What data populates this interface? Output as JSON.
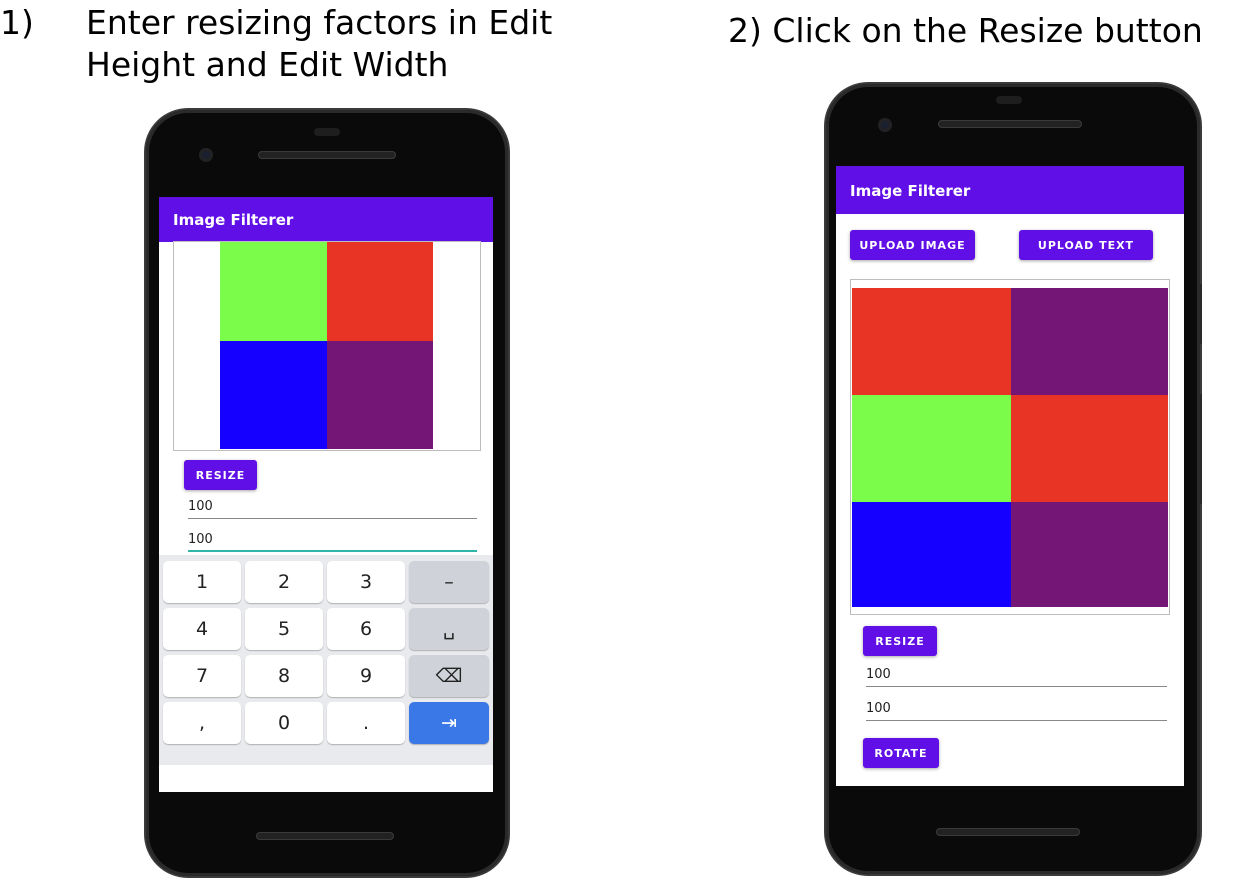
{
  "captions": {
    "step1_number": "1)",
    "step1_text": "Enter resizing factors in Edit Height and Edit Width",
    "step2_text": "2) Click on the Resize button"
  },
  "left_phone": {
    "app_title": "Image Filterer",
    "image_colors": [
      "#7cfc4a",
      "#e83424",
      "#1500ff",
      "#731675"
    ],
    "resize_label": "RESIZE",
    "height_value": "100",
    "width_value": "100",
    "keyboard": {
      "rows": [
        [
          "1",
          "2",
          "3",
          "–"
        ],
        [
          "4",
          "5",
          "6",
          "␣"
        ],
        [
          "7",
          "8",
          "9",
          "⌫"
        ],
        [
          ",",
          "0",
          ".",
          "⇥"
        ]
      ]
    }
  },
  "right_phone": {
    "app_title": "Image Filterer",
    "upload_image_label": "UPLOAD IMAGE",
    "upload_text_label": "UPLOAD TEXT",
    "image_colors": [
      "#e83424",
      "#731675",
      "#7cfc4a",
      "#e83424",
      "#1500ff",
      "#731675"
    ],
    "resize_label": "RESIZE",
    "height_value": "100",
    "width_value": "100",
    "rotate_label": "ROTATE"
  },
  "colors": {
    "accent": "#6010e6",
    "focus_line": "#2fb6a8",
    "enter_key": "#3b78e7"
  }
}
